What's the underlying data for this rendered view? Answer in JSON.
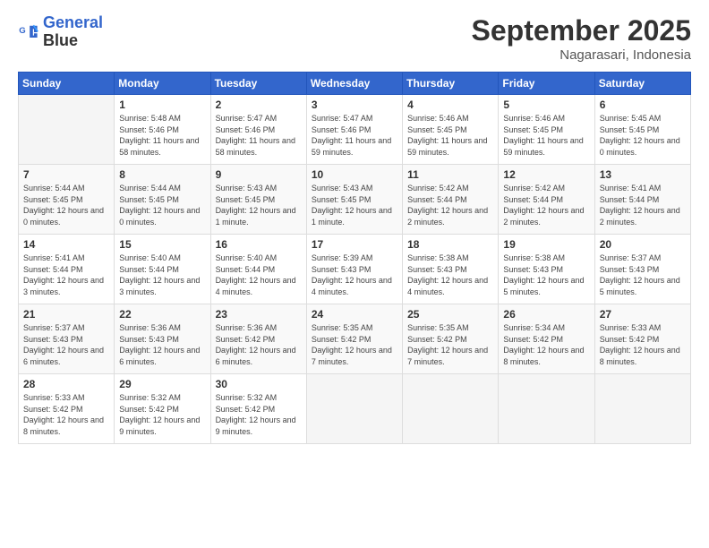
{
  "logo": {
    "line1": "General",
    "line2": "Blue"
  },
  "title": "September 2025",
  "subtitle": "Nagarasari, Indonesia",
  "weekdays": [
    "Sunday",
    "Monday",
    "Tuesday",
    "Wednesday",
    "Thursday",
    "Friday",
    "Saturday"
  ],
  "weeks": [
    [
      null,
      {
        "day": "1",
        "sunrise": "5:48 AM",
        "sunset": "5:46 PM",
        "daylight": "11 hours and 58 minutes."
      },
      {
        "day": "2",
        "sunrise": "5:47 AM",
        "sunset": "5:46 PM",
        "daylight": "11 hours and 58 minutes."
      },
      {
        "day": "3",
        "sunrise": "5:47 AM",
        "sunset": "5:46 PM",
        "daylight": "11 hours and 59 minutes."
      },
      {
        "day": "4",
        "sunrise": "5:46 AM",
        "sunset": "5:45 PM",
        "daylight": "11 hours and 59 minutes."
      },
      {
        "day": "5",
        "sunrise": "5:46 AM",
        "sunset": "5:45 PM",
        "daylight": "11 hours and 59 minutes."
      },
      {
        "day": "6",
        "sunrise": "5:45 AM",
        "sunset": "5:45 PM",
        "daylight": "12 hours and 0 minutes."
      }
    ],
    [
      {
        "day": "7",
        "sunrise": "5:44 AM",
        "sunset": "5:45 PM",
        "daylight": "12 hours and 0 minutes."
      },
      {
        "day": "8",
        "sunrise": "5:44 AM",
        "sunset": "5:45 PM",
        "daylight": "12 hours and 0 minutes."
      },
      {
        "day": "9",
        "sunrise": "5:43 AM",
        "sunset": "5:45 PM",
        "daylight": "12 hours and 1 minute."
      },
      {
        "day": "10",
        "sunrise": "5:43 AM",
        "sunset": "5:45 PM",
        "daylight": "12 hours and 1 minute."
      },
      {
        "day": "11",
        "sunrise": "5:42 AM",
        "sunset": "5:44 PM",
        "daylight": "12 hours and 2 minutes."
      },
      {
        "day": "12",
        "sunrise": "5:42 AM",
        "sunset": "5:44 PM",
        "daylight": "12 hours and 2 minutes."
      },
      {
        "day": "13",
        "sunrise": "5:41 AM",
        "sunset": "5:44 PM",
        "daylight": "12 hours and 2 minutes."
      }
    ],
    [
      {
        "day": "14",
        "sunrise": "5:41 AM",
        "sunset": "5:44 PM",
        "daylight": "12 hours and 3 minutes."
      },
      {
        "day": "15",
        "sunrise": "5:40 AM",
        "sunset": "5:44 PM",
        "daylight": "12 hours and 3 minutes."
      },
      {
        "day": "16",
        "sunrise": "5:40 AM",
        "sunset": "5:44 PM",
        "daylight": "12 hours and 4 minutes."
      },
      {
        "day": "17",
        "sunrise": "5:39 AM",
        "sunset": "5:43 PM",
        "daylight": "12 hours and 4 minutes."
      },
      {
        "day": "18",
        "sunrise": "5:38 AM",
        "sunset": "5:43 PM",
        "daylight": "12 hours and 4 minutes."
      },
      {
        "day": "19",
        "sunrise": "5:38 AM",
        "sunset": "5:43 PM",
        "daylight": "12 hours and 5 minutes."
      },
      {
        "day": "20",
        "sunrise": "5:37 AM",
        "sunset": "5:43 PM",
        "daylight": "12 hours and 5 minutes."
      }
    ],
    [
      {
        "day": "21",
        "sunrise": "5:37 AM",
        "sunset": "5:43 PM",
        "daylight": "12 hours and 6 minutes."
      },
      {
        "day": "22",
        "sunrise": "5:36 AM",
        "sunset": "5:43 PM",
        "daylight": "12 hours and 6 minutes."
      },
      {
        "day": "23",
        "sunrise": "5:36 AM",
        "sunset": "5:42 PM",
        "daylight": "12 hours and 6 minutes."
      },
      {
        "day": "24",
        "sunrise": "5:35 AM",
        "sunset": "5:42 PM",
        "daylight": "12 hours and 7 minutes."
      },
      {
        "day": "25",
        "sunrise": "5:35 AM",
        "sunset": "5:42 PM",
        "daylight": "12 hours and 7 minutes."
      },
      {
        "day": "26",
        "sunrise": "5:34 AM",
        "sunset": "5:42 PM",
        "daylight": "12 hours and 8 minutes."
      },
      {
        "day": "27",
        "sunrise": "5:33 AM",
        "sunset": "5:42 PM",
        "daylight": "12 hours and 8 minutes."
      }
    ],
    [
      {
        "day": "28",
        "sunrise": "5:33 AM",
        "sunset": "5:42 PM",
        "daylight": "12 hours and 8 minutes."
      },
      {
        "day": "29",
        "sunrise": "5:32 AM",
        "sunset": "5:42 PM",
        "daylight": "12 hours and 9 minutes."
      },
      {
        "day": "30",
        "sunrise": "5:32 AM",
        "sunset": "5:42 PM",
        "daylight": "12 hours and 9 minutes."
      },
      null,
      null,
      null,
      null
    ]
  ]
}
